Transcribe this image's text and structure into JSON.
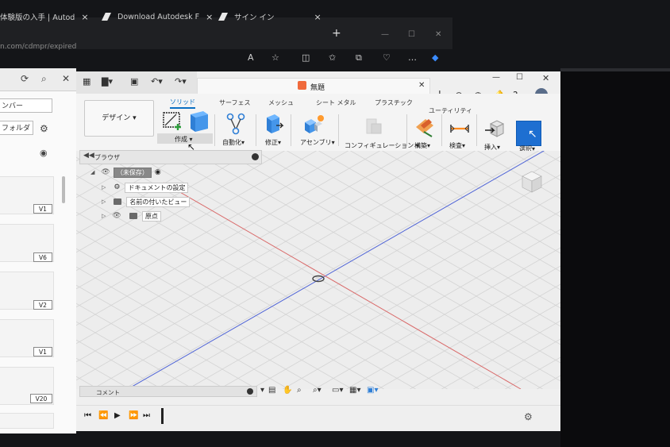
{
  "browser": {
    "tabs": [
      {
        "label": "体験版の入手 | Autod",
        "close": "×"
      },
      {
        "label": "Download Autodesk F",
        "close": "×"
      },
      {
        "label": "サイン イン",
        "close": "×"
      }
    ],
    "new_tab": "+",
    "address": "n.com/cdmpr/expired",
    "window_controls": {
      "minimize": "—",
      "maximize": "☐",
      "close": "✕"
    }
  },
  "left_panel": {
    "member_input": "ンバー",
    "folder_input": "フォルダ",
    "versions": [
      "V1",
      "V6",
      "V2",
      "V1",
      "V20"
    ]
  },
  "fusion": {
    "document_title": "無題",
    "design_button": "デザイン",
    "ribbon_tabs": [
      "ソリッド",
      "サーフェス",
      "メッシュ",
      "シート メタル",
      "プラスチック",
      "ユーティリティ"
    ],
    "active_tab": "ソリッド",
    "groups": [
      "作成",
      "自動化",
      "修正",
      "アセンブリ",
      "コンフィギュレーション",
      "構築",
      "検査",
      "挿入",
      "選択"
    ],
    "browser_label": "ブラウザ",
    "tree": {
      "root": "（未保存）",
      "items": [
        "ドキュメントの設定",
        "名前の付いたビュー",
        "原点"
      ]
    },
    "comment_label": "コメント",
    "window_controls": {
      "minimize": "—",
      "maximize": "☐",
      "close": "✕"
    },
    "tab_close": "✕",
    "tab_add": "+"
  },
  "colors": {
    "accent": "#0b6fc3",
    "x_axis": "#d9534f",
    "y_axis": "#3b5bd1",
    "grid": "#d0d0d0"
  }
}
